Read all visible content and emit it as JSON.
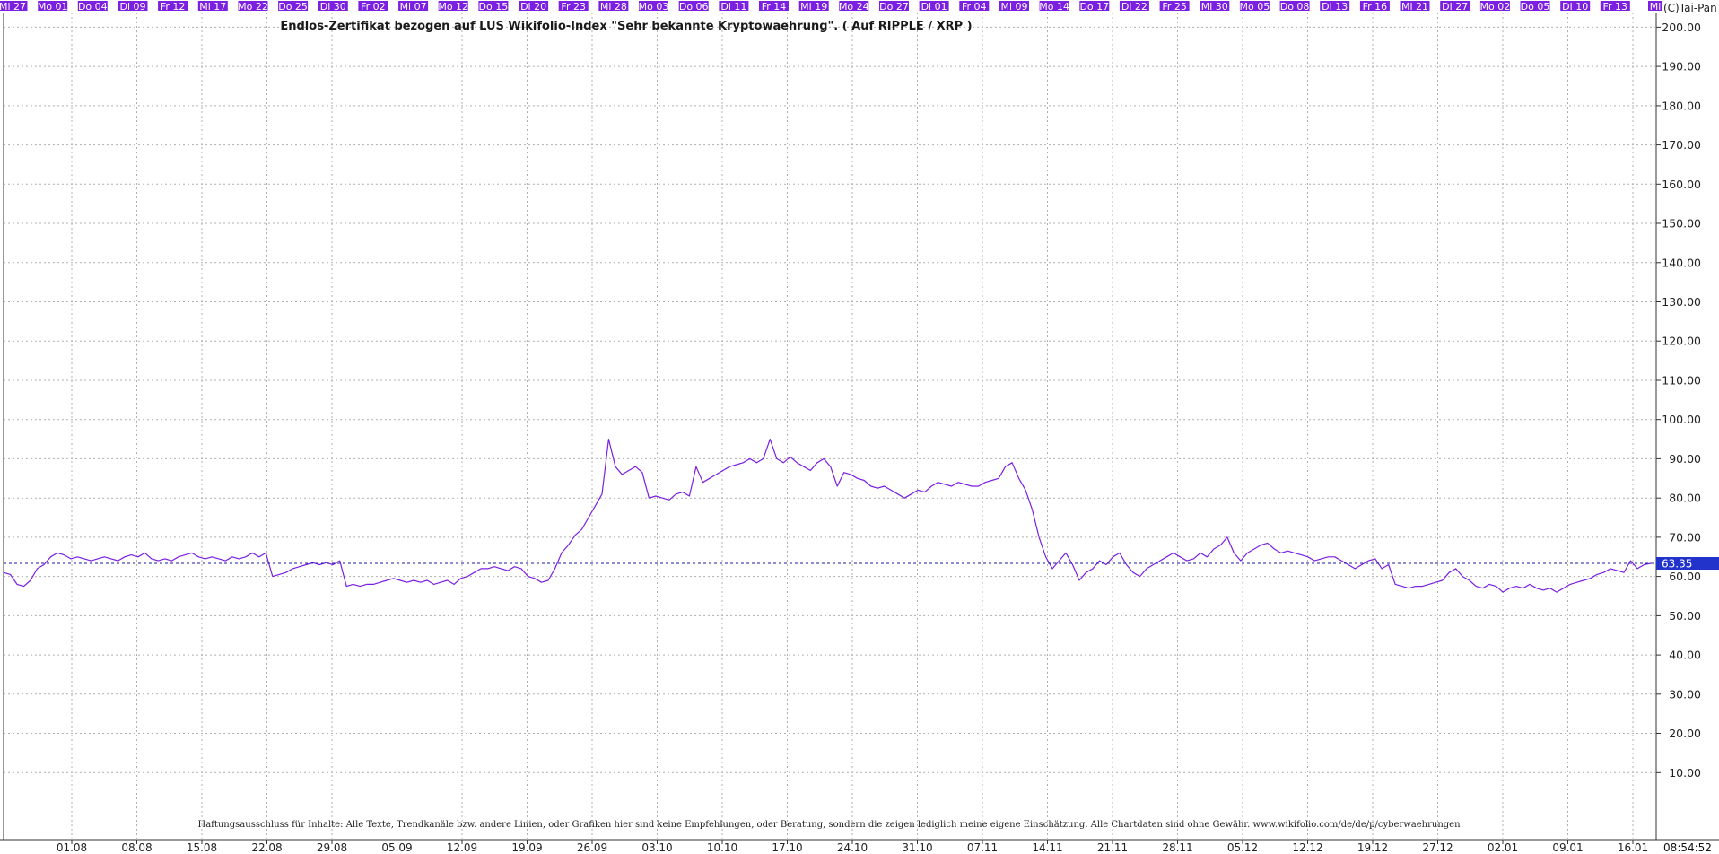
{
  "copyright": "(C)Tai-Pan",
  "clock": "08:54:52",
  "disclaimer": "Haftungsausschluss für Inhalte: Alle Texte, Trendkanäle bzw. andere Linien, oder Grafiken hier sind keine Empfehlungen, oder Beratung, sondern die zeigen lediglich meine eigene Einschätzung. Alle Chartdaten sind ohne Gewähr. www.wikifolio.com/de/de/p/cyberwaehrungen",
  "colors": {
    "line": "#7b1fe0",
    "day_bar": "#7b1fe0",
    "last_label_bg": "#2233cc",
    "grid": "#b0b0b0"
  },
  "day_labels": [
    "Mi 27",
    "Mo 01",
    "Do 04",
    "Di 09",
    "Fr 12",
    "Mi 17",
    "Mo 22",
    "Do 25",
    "Di 30",
    "Fr 02",
    "Mi 07",
    "Mo 12",
    "Do 15",
    "Di 20",
    "Fr 23",
    "Mi 28",
    "Mo 03",
    "Do 06",
    "Di 11",
    "Fr 14",
    "Mi 19",
    "Mo 24",
    "Do 27",
    "Di 01",
    "Fr 04",
    "Mi 09",
    "Mo 14",
    "Do 17",
    "Di 22",
    "Fr 25",
    "Mi 30",
    "Mo 05",
    "Do 08",
    "Di 13",
    "Fr 16",
    "Mi 21",
    "Di 27",
    "Mo 02",
    "Do 05",
    "Di 10",
    "Fr 13",
    "Mi"
  ],
  "chart_data": {
    "type": "line",
    "title": "Endlos-Zertifikat bezogen auf LUS Wikifolio-Index \"Sehr bekannte Kryptowaehrung\". ( Auf RIPPLE / XRP )",
    "xlabel": "",
    "ylabel": "",
    "ylim": [
      0,
      210
    ],
    "yticks": [
      10,
      20,
      30,
      40,
      50,
      60,
      70,
      80,
      90,
      100,
      110,
      120,
      130,
      140,
      150,
      160,
      170,
      180,
      190,
      200
    ],
    "ytick_labels": [
      "10.00",
      "20.00",
      "30.00",
      "40.00",
      "50.00",
      "60.00",
      "70.00",
      "80.00",
      "90.00",
      "100.00",
      "110.00",
      "120.00",
      "130.00",
      "140.00",
      "150.00",
      "160.00",
      "170.00",
      "180.00",
      "190.00",
      "200.00"
    ],
    "xtick_labels": [
      "01.08",
      "08.08",
      "15.08",
      "22.08",
      "29.08",
      "05.09",
      "12.09",
      "19.09",
      "26.09",
      "03.10",
      "10.10",
      "17.10",
      "24.10",
      "31.10",
      "07.11",
      "14.11",
      "21.11",
      "28.11",
      "05.12",
      "12.12",
      "19.12",
      "27.12",
      "02.01",
      "09.01",
      "16.01"
    ],
    "grid": true,
    "last_value": 63.35,
    "last_value_label": "63.35",
    "series": [
      {
        "values": [
          61,
          60.5,
          58,
          57.5,
          59,
          62,
          63,
          65,
          66,
          65.5,
          64.5,
          65,
          64.5,
          64,
          64.5,
          65,
          64.5,
          64,
          65,
          65.5,
          65,
          66,
          64.5,
          64,
          64.5,
          64,
          65,
          65.5,
          66,
          65,
          64.5,
          65,
          64.5,
          64,
          65,
          64.5,
          65,
          66,
          65,
          66,
          60,
          60.5,
          61,
          62,
          62.5,
          63,
          63.5,
          63,
          63.5,
          63,
          64,
          57.5,
          58,
          57.5,
          58,
          58,
          58.5,
          59,
          59.5,
          59,
          58.5,
          59,
          58.5,
          59,
          58,
          58.5,
          59,
          58,
          59.5,
          60,
          61,
          62,
          62,
          62.5,
          62,
          61.5,
          62.5,
          62,
          60,
          59.5,
          58.5,
          59,
          62,
          66,
          68,
          70.5,
          72,
          75,
          78,
          81,
          95,
          88,
          86,
          87,
          88,
          86.5,
          80,
          80.5,
          80,
          79.5,
          81,
          81.5,
          80.5,
          88,
          84,
          85,
          86,
          87,
          88,
          88.5,
          89,
          90,
          89,
          90,
          95,
          90,
          89,
          90.5,
          89,
          88,
          87,
          89,
          90,
          88,
          83,
          86.5,
          86,
          85,
          84.5,
          83,
          82.5,
          83,
          82,
          81,
          80,
          81,
          82,
          81.5,
          83,
          84,
          83.5,
          83,
          84,
          83.5,
          83,
          83,
          84,
          84.5,
          85,
          88,
          89,
          85,
          82,
          77,
          70,
          65,
          62,
          64,
          66,
          63,
          59,
          61,
          62,
          64,
          63,
          65,
          66,
          63,
          61,
          60,
          62,
          63,
          64,
          65,
          66,
          65,
          64,
          64.5,
          66,
          65,
          67,
          68,
          70,
          66,
          64,
          66,
          67,
          68,
          68.5,
          67,
          66,
          66.5,
          66,
          65.5,
          65,
          64,
          64.5,
          65,
          65,
          64,
          63,
          62,
          63,
          64,
          64.5,
          62,
          63,
          58,
          57.5,
          57,
          57.5,
          57.5,
          58,
          58.5,
          59,
          61,
          62,
          60,
          59,
          57.5,
          57,
          58,
          57.5,
          56,
          57,
          57.5,
          57,
          58,
          57,
          56.5,
          57,
          56,
          57,
          58,
          58.5,
          59,
          59.5,
          60.5,
          61,
          62,
          61.5,
          61,
          64,
          62,
          63,
          63.35
        ]
      }
    ]
  }
}
